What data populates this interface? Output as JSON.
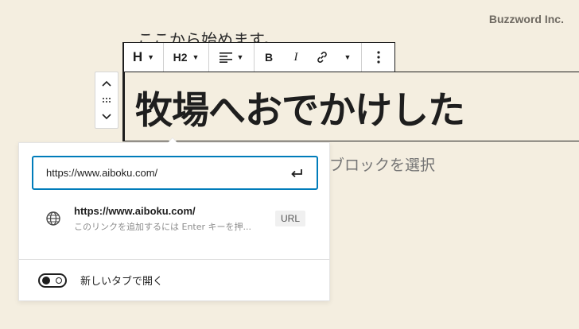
{
  "watermark": "Buzzword Inc.",
  "editor": {
    "intro_text": "ここから始めます。",
    "heading_text": "牧場へおでかけした",
    "placeholder_tail": "ブロックを選択"
  },
  "toolbar": {
    "block_type_label": "H",
    "heading_level_label": "H2",
    "bold_label": "B",
    "italic_label": "I"
  },
  "icons": {
    "block_type": "heading-icon",
    "align": "align-left-icon",
    "link": "link-icon",
    "more": "more-vertical-icon",
    "up": "chevron-up-icon",
    "drag": "drag-handle-icon",
    "down": "chevron-down-icon",
    "submit": "enter-return-icon",
    "suggestion": "globe-icon"
  },
  "link_popover": {
    "url_value": "https://www.aiboku.com/",
    "suggestion": {
      "title": "https://www.aiboku.com/",
      "info": "このリンクを追加するには Enter キーを押...",
      "badge": "URL"
    },
    "new_tab_label": "新しいタブで開く",
    "new_tab_enabled": false
  },
  "colors": {
    "background": "#f4eee0",
    "focus": "#007cba"
  }
}
